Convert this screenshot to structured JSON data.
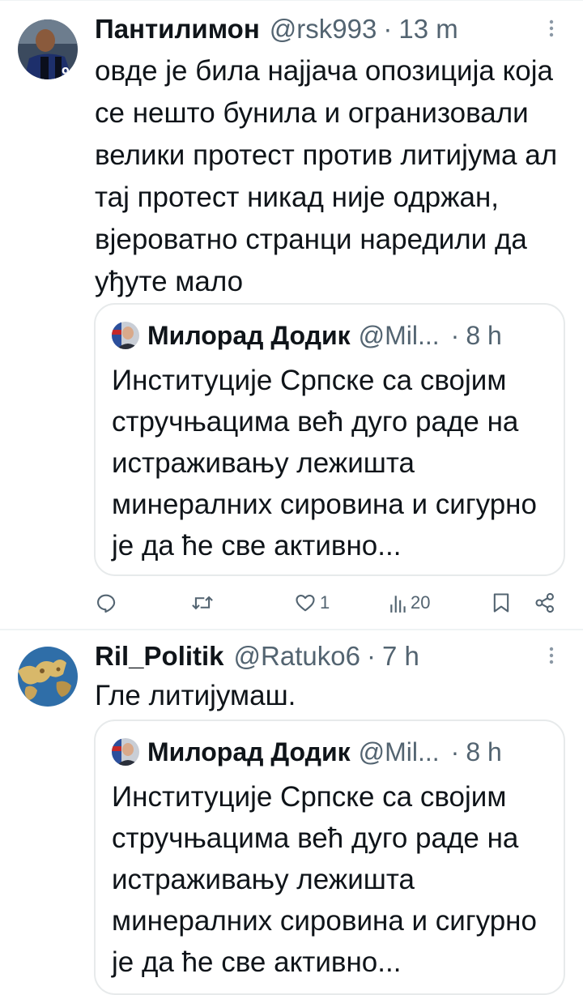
{
  "tweets": [
    {
      "name": "Пантилимон",
      "handle": "@rsk993",
      "separator": "·",
      "time": "13 m",
      "avatar_icon": "soccer-player-avatar",
      "text": "овде је била најјача опозиција која се нешто бунила и огранизовали велики протест против литијума ал тај протест никад није одржан, вјероватно странци наредили да уђуте мало",
      "quote": {
        "name": "Милорад Додик",
        "handle": "@Mil...",
        "separator": "·",
        "time": "8 h",
        "avatar_icon": "politician-avatar",
        "text": "Институције Српске са својим стручњацима већ дуго раде на истраживању лежишта минералних сировина и сигурно је да ће све активно..."
      },
      "actions": {
        "reply_count": "",
        "retweet_count": "",
        "like_count": "1",
        "views_count": "20"
      }
    },
    {
      "name": "Ril_Politik",
      "handle": "@Ratuko6",
      "separator": "·",
      "time": "7 h",
      "avatar_icon": "map-avatar",
      "text": "Гле литијумаш.",
      "quote": {
        "name": "Милорад Додик",
        "handle": "@Mil...",
        "separator": "·",
        "time": "8 h",
        "avatar_icon": "politician-avatar",
        "text": "Институције Српске са својим стручњацима већ дуго раде на истраживању лежишта минералних сировина и сигурно је да ће све активно..."
      }
    }
  ],
  "colors": {
    "text": "#0f1419",
    "secondary": "#536471",
    "border": "#eff3f4"
  }
}
